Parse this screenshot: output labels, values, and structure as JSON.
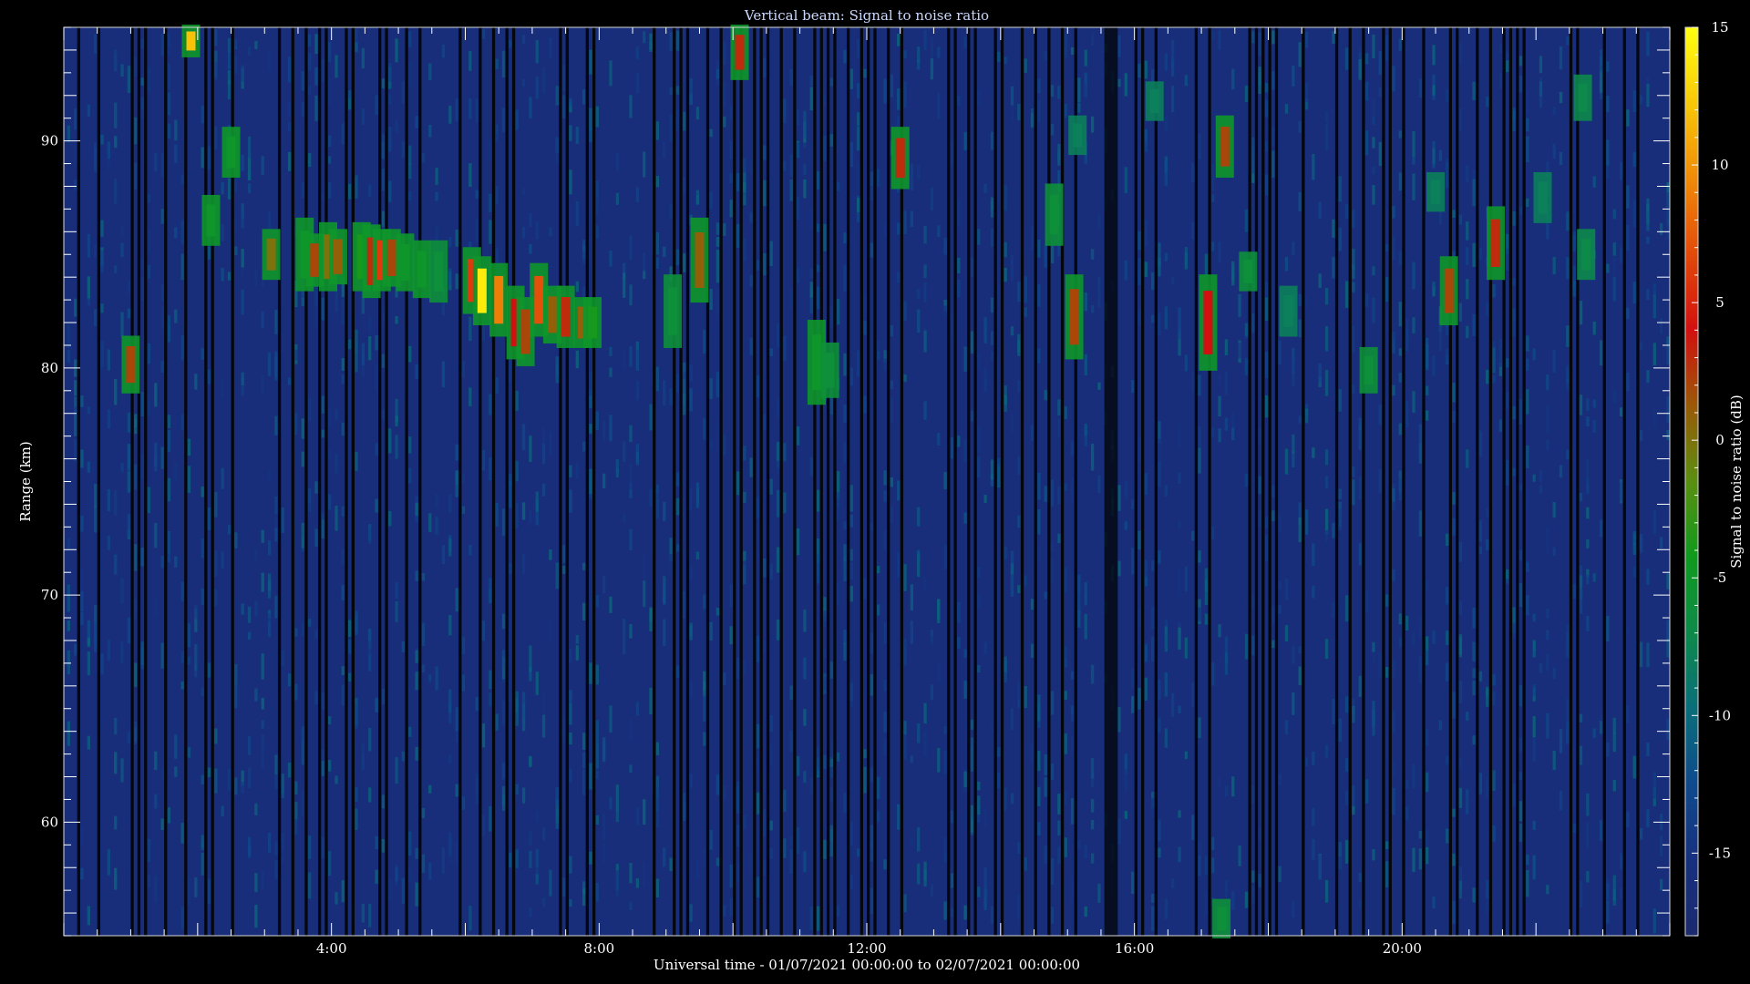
{
  "chart_data": {
    "type": "heatmap",
    "title": "Vertical beam: Signal to noise ratio",
    "xlabel": "Universal time - 01/07/2021 00:00:00 to 02/07/2021 00:00:00",
    "ylabel": "Range (km)",
    "xlim": [
      0,
      24
    ],
    "ylim": [
      55,
      95
    ],
    "x_ticks": [
      {
        "value": 4,
        "label": "4:00"
      },
      {
        "value": 8,
        "label": "8:00"
      },
      {
        "value": 12,
        "label": "12:00"
      },
      {
        "value": 16,
        "label": "16:00"
      },
      {
        "value": 20,
        "label": "20:00"
      }
    ],
    "y_ticks": [
      {
        "value": 60,
        "label": "60"
      },
      {
        "value": 70,
        "label": "70"
      },
      {
        "value": 80,
        "label": "80"
      },
      {
        "value": 90,
        "label": "90"
      }
    ],
    "colorbar": {
      "label": "Signal to noise ratio (dB)",
      "range": [
        -18,
        15
      ],
      "ticks": [
        {
          "value": 15,
          "label": "15"
        },
        {
          "value": 10,
          "label": "10"
        },
        {
          "value": 5,
          "label": "5"
        },
        {
          "value": 0,
          "label": "0"
        },
        {
          "value": -5,
          "label": "-5"
        },
        {
          "value": -10,
          "label": "-10"
        },
        {
          "value": -15,
          "label": "-15"
        }
      ],
      "colors": [
        "#1c2a6e",
        "#17307f",
        "#0f4a8c",
        "#0a6e7a",
        "#0d8a4a",
        "#0f9a1e",
        "#5a8f10",
        "#9a5a08",
        "#d21010",
        "#e24a0a",
        "#f08a08",
        "#f8c808",
        "#ffff10"
      ]
    },
    "background_db": -16,
    "echoes": [
      {
        "t": 1.0,
        "range_min": 79.0,
        "range_max": 81.3,
        "snr_db": 2
      },
      {
        "t": 1.9,
        "range_min": 93.8,
        "range_max": 95.0,
        "snr_db": 12
      },
      {
        "t": 2.2,
        "range_min": 85.5,
        "range_max": 87.5,
        "snr_db": -5
      },
      {
        "t": 2.5,
        "range_min": 88.5,
        "range_max": 90.5,
        "snr_db": -5
      },
      {
        "t": 3.1,
        "range_min": 84.0,
        "range_max": 86.0,
        "snr_db": 0
      },
      {
        "t": 3.6,
        "range_min": 83.5,
        "range_max": 86.5,
        "snr_db": -5
      },
      {
        "t": 3.75,
        "range_min": 83.7,
        "range_max": 85.8,
        "snr_db": 2
      },
      {
        "t": 3.95,
        "range_min": 83.5,
        "range_max": 86.3,
        "snr_db": 0
      },
      {
        "t": 4.1,
        "range_min": 83.8,
        "range_max": 86.0,
        "snr_db": 1
      },
      {
        "t": 4.45,
        "range_min": 83.5,
        "range_max": 86.3,
        "snr_db": -4
      },
      {
        "t": 4.6,
        "range_min": 83.2,
        "range_max": 86.2,
        "snr_db": 3
      },
      {
        "t": 4.75,
        "range_min": 83.5,
        "range_max": 86.0,
        "snr_db": 6
      },
      {
        "t": 4.9,
        "range_min": 83.7,
        "range_max": 86.0,
        "snr_db": 2
      },
      {
        "t": 5.1,
        "range_min": 83.5,
        "range_max": 85.8,
        "snr_db": -5
      },
      {
        "t": 5.35,
        "range_min": 83.2,
        "range_max": 85.5,
        "snr_db": -5
      },
      {
        "t": 5.6,
        "range_min": 83.0,
        "range_max": 85.5,
        "snr_db": -6
      },
      {
        "t": 6.1,
        "range_min": 82.5,
        "range_max": 85.2,
        "snr_db": 6
      },
      {
        "t": 6.25,
        "range_min": 82.0,
        "range_max": 84.8,
        "snr_db": 14
      },
      {
        "t": 6.5,
        "range_min": 81.5,
        "range_max": 84.5,
        "snr_db": 9
      },
      {
        "t": 6.75,
        "range_min": 80.5,
        "range_max": 83.5,
        "snr_db": 4
      },
      {
        "t": 6.9,
        "range_min": 80.2,
        "range_max": 83.0,
        "snr_db": 2
      },
      {
        "t": 7.1,
        "range_min": 81.5,
        "range_max": 84.5,
        "snr_db": 7
      },
      {
        "t": 7.3,
        "range_min": 81.2,
        "range_max": 83.5,
        "snr_db": 1
      },
      {
        "t": 7.5,
        "range_min": 81.0,
        "range_max": 83.5,
        "snr_db": 3
      },
      {
        "t": 7.75,
        "range_min": 81.0,
        "range_max": 83.0,
        "snr_db": 1
      },
      {
        "t": 7.9,
        "range_min": 81.0,
        "range_max": 83.0,
        "snr_db": -4
      },
      {
        "t": 9.1,
        "range_min": 81.0,
        "range_max": 84.0,
        "snr_db": -6
      },
      {
        "t": 9.5,
        "range_min": 83.0,
        "range_max": 86.5,
        "snr_db": 1
      },
      {
        "t": 10.1,
        "range_min": 92.8,
        "range_max": 95.0,
        "snr_db": 3
      },
      {
        "t": 11.25,
        "range_min": 78.5,
        "range_max": 82.0,
        "snr_db": -5
      },
      {
        "t": 11.45,
        "range_min": 78.8,
        "range_max": 81.0,
        "snr_db": -6
      },
      {
        "t": 12.5,
        "range_min": 88.0,
        "range_max": 90.5,
        "snr_db": 3
      },
      {
        "t": 14.8,
        "range_min": 85.5,
        "range_max": 88.0,
        "snr_db": -6
      },
      {
        "t": 15.1,
        "range_min": 80.5,
        "range_max": 84.0,
        "snr_db": 2
      },
      {
        "t": 15.15,
        "range_min": 89.5,
        "range_max": 91.0,
        "snr_db": -8
      },
      {
        "t": 16.3,
        "range_min": 91.0,
        "range_max": 92.5,
        "snr_db": -8
      },
      {
        "t": 17.1,
        "range_min": 80.0,
        "range_max": 84.0,
        "snr_db": 4
      },
      {
        "t": 17.35,
        "range_min": 88.5,
        "range_max": 91.0,
        "snr_db": 2
      },
      {
        "t": 17.3,
        "range_min": 55.0,
        "range_max": 56.5,
        "snr_db": -6
      },
      {
        "t": 17.7,
        "range_min": 83.5,
        "range_max": 85.0,
        "snr_db": -6
      },
      {
        "t": 18.3,
        "range_min": 81.5,
        "range_max": 83.5,
        "snr_db": -8
      },
      {
        "t": 19.5,
        "range_min": 79.0,
        "range_max": 80.8,
        "snr_db": -6
      },
      {
        "t": 20.5,
        "range_min": 87.0,
        "range_max": 88.5,
        "snr_db": -8
      },
      {
        "t": 20.7,
        "range_min": 82.0,
        "range_max": 84.8,
        "snr_db": 2
      },
      {
        "t": 21.4,
        "range_min": 84.0,
        "range_max": 87.0,
        "snr_db": 3
      },
      {
        "t": 22.1,
        "range_min": 86.5,
        "range_max": 88.5,
        "snr_db": -8
      },
      {
        "t": 22.7,
        "range_min": 91.0,
        "range_max": 92.8,
        "snr_db": -7
      },
      {
        "t": 22.75,
        "range_min": 84.0,
        "range_max": 86.0,
        "snr_db": -7
      }
    ]
  }
}
